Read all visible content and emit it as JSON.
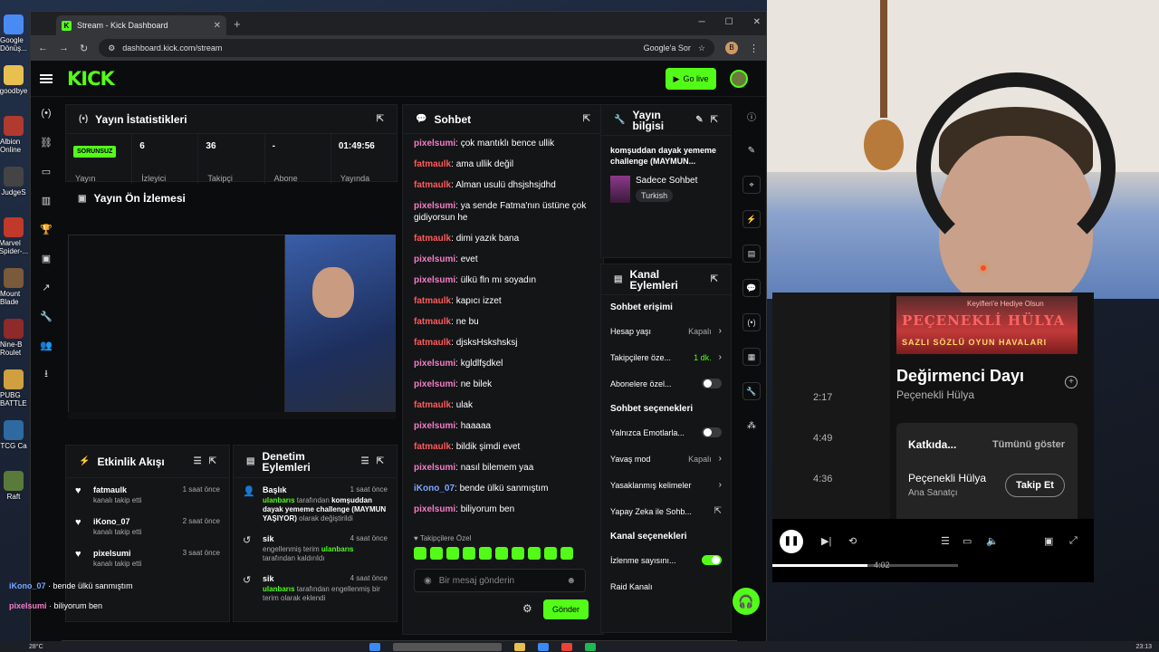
{
  "browser": {
    "tab_title": "Stream - Kick Dashboard",
    "url": "dashboard.kick.com/stream",
    "google_chip": "Google'a Sor",
    "profile_initial": "B"
  },
  "kick": {
    "logo": "KICK",
    "go_live": "Go live"
  },
  "stats_panel": {
    "title": "Yayın İstatistikleri",
    "status": "SORUNSUZ",
    "stream_label": "Yayın",
    "items": [
      {
        "value": "6",
        "label": "İzleyici"
      },
      {
        "value": "36",
        "label": "Takipçi"
      },
      {
        "value": "-",
        "label": "Abone"
      },
      {
        "value": "01:49:56",
        "label": "Yayında"
      }
    ]
  },
  "preview_panel": {
    "title": "Yayın Ön İzlemesi"
  },
  "activity": {
    "title": "Etkinlik Akışı",
    "items": [
      {
        "name": "fatmaulk",
        "sub": "kanalı takip etti",
        "time": "1 saat önce"
      },
      {
        "name": "iKono_07",
        "sub": "kanalı takip etti",
        "time": "2 saat önce"
      },
      {
        "name": "pixelsumi",
        "sub": "kanalı takip etti",
        "time": "3 saat önce"
      }
    ]
  },
  "moderation": {
    "title": "Denetim Eylemleri",
    "items": [
      {
        "title": "Başlık",
        "time": "1 saat önce",
        "who": "ulanbarıs",
        "d1": " tarafından ",
        "what": "komşuddan dayak yememe challenge (MAYMUN YAŞIYOR)",
        "d2": " olarak değiştirildi"
      },
      {
        "title": "sik",
        "time": "4 saat önce",
        "d1": "engellenmiş terim ",
        "who": "ulanbarıs",
        "d2": " tarafından kaldırıldı"
      },
      {
        "title": "sik",
        "time": "4 saat önce",
        "who": "ulanbarıs",
        "d1": " tarafından engellenmiş bir terim olarak eklendi"
      }
    ]
  },
  "chat": {
    "title": "Sohbet",
    "messages": [
      {
        "user": "pixelsumi",
        "text": "çok mantıklı bence ullik",
        "c": "c1"
      },
      {
        "user": "fatmaulk",
        "text": "ama ullik değil",
        "c": "c2"
      },
      {
        "user": "fatmaulk",
        "text": "Alman usulü dhsjshsjdhd",
        "c": "c2"
      },
      {
        "user": "pixelsumi",
        "text": "ya sende Fatma'nın üstüne çok gidiyorsun he",
        "c": "c1"
      },
      {
        "user": "fatmaulk",
        "text": "dimi yazık bana",
        "c": "c2"
      },
      {
        "user": "pixelsumi",
        "text": "evet",
        "c": "c1"
      },
      {
        "user": "pixelsumi",
        "text": "ülkü fln mı soyadın",
        "c": "c1"
      },
      {
        "user": "fatmaulk",
        "text": "kapıcı izzet",
        "c": "c2"
      },
      {
        "user": "fatmaulk",
        "text": "ne bu",
        "c": "c2"
      },
      {
        "user": "fatmaulk",
        "text": "djsksHskshsksj",
        "c": "c2"
      },
      {
        "user": "pixelsumi",
        "text": "kgldlfşdkel",
        "c": "c1"
      },
      {
        "user": "pixelsumi",
        "text": "ne bilek",
        "c": "c1"
      },
      {
        "user": "fatmaulk",
        "text": "ulak",
        "c": "c2"
      },
      {
        "user": "pixelsumi",
        "text": "haaaaa",
        "c": "c1"
      },
      {
        "user": "fatmaulk",
        "text": "bildik şimdi evet",
        "c": "c2"
      },
      {
        "user": "pixelsumi",
        "text": "nasıl bilemem yaa",
        "c": "c1"
      },
      {
        "user": "iKono_07",
        "text": "bende ülkü sanmıştım",
        "c": "c3"
      },
      {
        "user": "pixelsumi",
        "text": "biliyorum ben",
        "c": "c1"
      }
    ],
    "followers_only": "Takipçilere Özel",
    "input_placeholder": "Bir mesaj gönderin",
    "send": "Gönder"
  },
  "stream_info": {
    "title": "Yayın bilgisi",
    "stream_title": "komşuddan dayak yememe challenge (MAYMUN...",
    "category": "Sadece Sohbet",
    "language": "Turkish"
  },
  "channel_actions": {
    "title": "Kanal Eylemleri",
    "chat_access": "Sohbet erişimi",
    "rows1": [
      {
        "label": "Hesap yaşı",
        "value": "Kapalı",
        "kind": "chev"
      },
      {
        "label": "Takipçilere öze...",
        "value": "1 dk.",
        "kind": "chev",
        "green": true
      },
      {
        "label": "Abonelere özel...",
        "value": "",
        "kind": "toggle"
      }
    ],
    "chat_options": "Sohbet seçenekleri",
    "rows2": [
      {
        "label": "Yalnızca Emotlarla...",
        "value": "",
        "kind": "toggle"
      },
      {
        "label": "Yavaş mod",
        "value": "Kapalı",
        "kind": "chev"
      },
      {
        "label": "Yasaklanmış kelimeler",
        "value": "",
        "kind": "chev"
      },
      {
        "label": "Yapay Zeka ile Sohb...",
        "value": "",
        "kind": "ext"
      }
    ],
    "channel_options": "Kanal seçenekleri",
    "rows3": [
      {
        "label": "İzlenme sayısını...",
        "value": "",
        "kind": "toggle-on"
      },
      {
        "label": "Raid Kanalı",
        "value": "",
        "kind": "none"
      }
    ]
  },
  "overlay": [
    {
      "user": "iKono_07",
      "text": "bende ülkü sanmıştım"
    },
    {
      "user": "pixelsumi",
      "text": "biliyorum ben"
    }
  ],
  "spotify": {
    "album_top": "Keyifleri'e Hediye Olsun",
    "album_title": "PEÇENEKLİ HÜLYA",
    "album_sub": "SAZLI SÖZLÜ OYUN HAVALARI",
    "song": "Değirmenci Dayı",
    "artist": "Peçenekli Hülya",
    "durations": [
      "2:17",
      "4:49",
      "4:36"
    ],
    "credits": "Katkıda...",
    "show_all": "Tümünü göster",
    "credit_artist": "Peçenekli Hülya",
    "credit_role": "Ana Sanatçı",
    "follow": "Takip Et",
    "time": "4:02"
  },
  "desktop": {
    "icons": [
      "Google Dönüş...",
      "goodbye",
      "Albion Online",
      "JudgeS",
      "Marvel Spider-...",
      "Mount Blade",
      "Nine-B Roulet",
      "PUBG BATTLE",
      "TCG Ca",
      "Raft"
    ],
    "weather": "28°C",
    "clock": "23:13"
  },
  "colors": {
    "accent": "#53fc18",
    "bg": "#0b0c0e",
    "panel": "#141517"
  }
}
